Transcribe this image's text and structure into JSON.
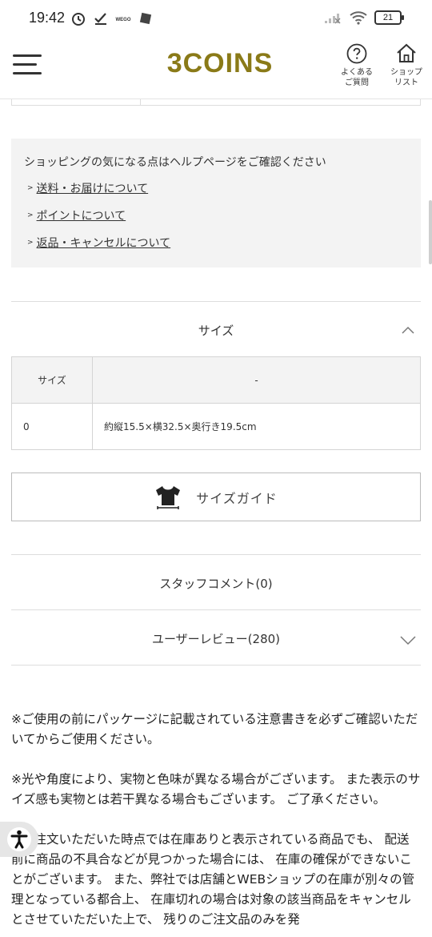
{
  "status_bar": {
    "time": "19:42",
    "battery": "21"
  },
  "header": {
    "logo": "3COINS",
    "faq_label_line1": "よくある",
    "faq_label_line2": "ご質問",
    "shop_label_line1": "ショップ",
    "shop_label_line2": "リスト",
    "brand_color": "#8a7a18"
  },
  "help": {
    "title": "ショッピングの気になる点はヘルプページをご確認ください",
    "links": [
      {
        "arrow": ">",
        "label": "送料・お届けについて"
      },
      {
        "arrow": ">",
        "label": "ポイントについて"
      },
      {
        "arrow": ">",
        "label": "返品・キャンセルについて"
      }
    ]
  },
  "size_section": {
    "title": "サイズ",
    "state": "expanded",
    "table": {
      "header": [
        "サイズ",
        "-"
      ],
      "rows": [
        [
          "0",
          "約縦15.5×横32.5×奥行き19.5cm"
        ]
      ]
    },
    "size_guide_label": "サイズガイド"
  },
  "staff_comment": {
    "title": "スタッフコメント(0)"
  },
  "user_review": {
    "title": "ユーザーレビュー(280)",
    "state": "collapsed"
  },
  "notes": [
    "※ご使用の前にパッケージに記載されている注意書きを必ずご確認いただいてからご使用ください。",
    "※光や角度により、実物と色味が異なる場合がございます。 また表示のサイズ感も実物とは若干異なる場合もございます。 ご了承ください。",
    "※ご注文いただいた時点では在庫ありと表示されている商品でも、 配送前に商品の不具合などが見つかった場合には、 在庫の確保ができないことがございます。 また、弊社では店舗とWEBショップの在庫が別々の管理となっている都合上、 在庫切れの場合は対象の該当商品をキャンセルとさせていただいた上で、 残りのご注文品のみを発"
  ]
}
